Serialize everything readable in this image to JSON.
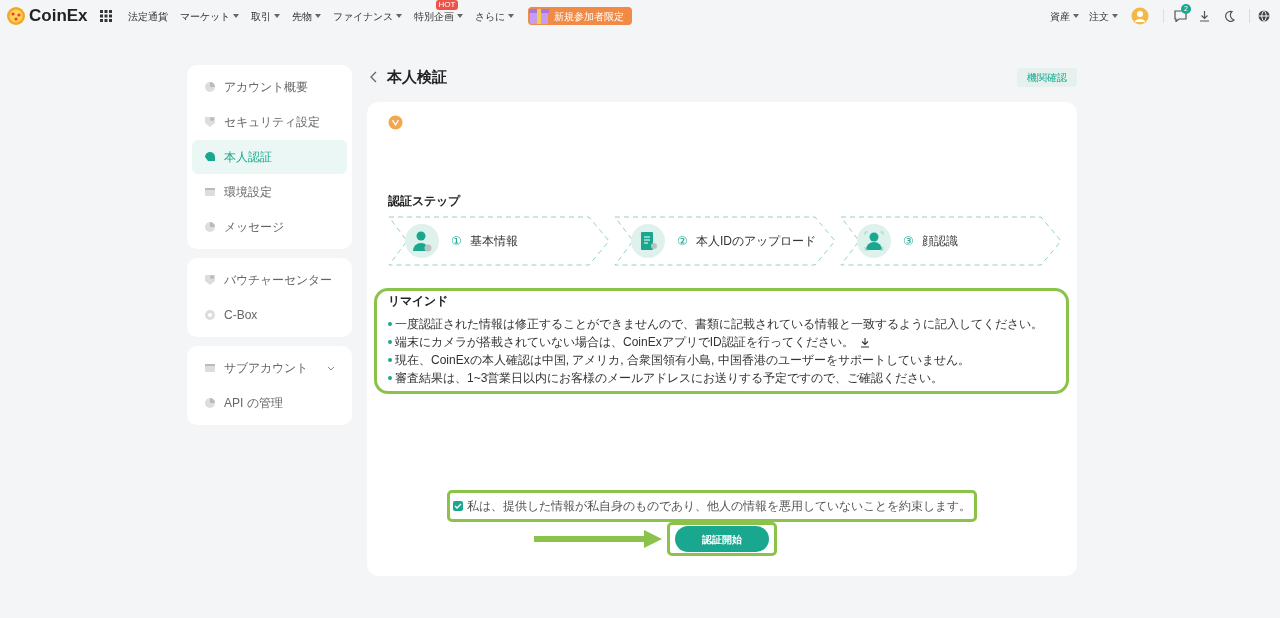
{
  "header": {
    "logo": "CoinEx",
    "nav": [
      {
        "label": "法定通貨",
        "dropdown": false
      },
      {
        "label": "マーケット",
        "dropdown": true
      },
      {
        "label": "取引",
        "dropdown": true
      },
      {
        "label": "先物",
        "dropdown": true
      },
      {
        "label": "ファイナンス",
        "dropdown": true
      },
      {
        "label": "特別企画",
        "dropdown": true,
        "badge": "HOT"
      },
      {
        "label": "さらに",
        "dropdown": true
      }
    ],
    "promo": "新規参加者限定",
    "right": [
      {
        "label": "資産"
      },
      {
        "label": "注文"
      }
    ],
    "notification_count": "2"
  },
  "sidebar": {
    "groups": [
      [
        {
          "label": "アカウント概要",
          "selected": false
        },
        {
          "label": "セキュリティ設定",
          "selected": false
        },
        {
          "label": "本人認証",
          "selected": true
        },
        {
          "label": "環境設定",
          "selected": false
        },
        {
          "label": "メッセージ",
          "selected": false
        }
      ],
      [
        {
          "label": "バウチャーセンター",
          "selected": false
        },
        {
          "label": "C-Box",
          "selected": false
        }
      ],
      [
        {
          "label": "サブアカウント",
          "selected": false,
          "expandable": true
        },
        {
          "label": "API の管理",
          "selected": false
        }
      ]
    ]
  },
  "page": {
    "title": "本人検証",
    "top_button": "機関確認",
    "steps_title": "認証ステップ",
    "steps": [
      {
        "number": "①",
        "label": "基本情報",
        "kind": "person"
      },
      {
        "number": "②",
        "label": "本人IDのアップロード",
        "kind": "document"
      },
      {
        "number": "③",
        "label": "顔認識",
        "kind": "face"
      }
    ],
    "remind_title": "リマインド",
    "remind_items": [
      {
        "text": "一度認証された情報は修正することができませんので、書類に記載されている情報と一致するように記入してください。",
        "download": false
      },
      {
        "text": "端末にカメラが搭載されていない場合は、CoinExアプリでID認証を行ってください。",
        "download": true
      },
      {
        "text": "現在、CoinExの本人確認は中国, アメリカ, 合衆国領有小島, 中国香港のユーザーをサポートしていません。",
        "download": false
      },
      {
        "text": "審査結果は、1~3営業日以内にお客様のメールアドレスにお送りする予定ですので、ご確認ください。",
        "download": false
      }
    ],
    "agreement": {
      "text": "私は、提供した情報が私自身のものであり、他人の情報を悪用していないことを約束します。",
      "checked": true
    },
    "start_button": "認証開始"
  }
}
